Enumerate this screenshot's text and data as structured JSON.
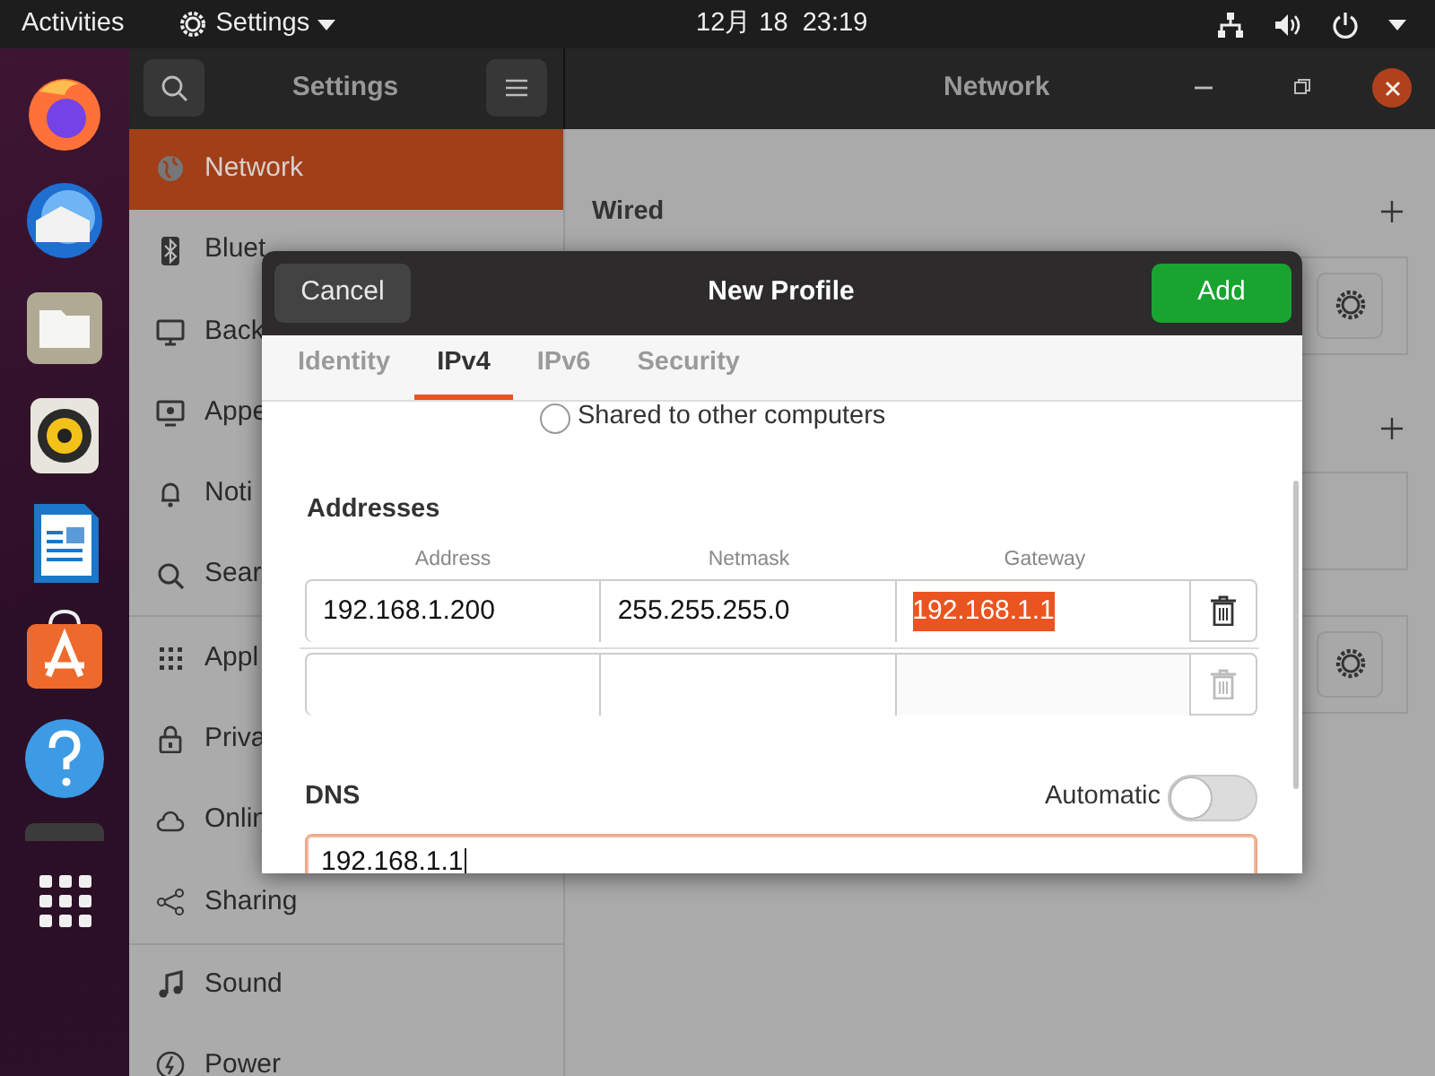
{
  "top_bar": {
    "activities": "Activities",
    "app_menu": "Settings",
    "clock": "12月 18  23:19"
  },
  "window": {
    "sidebar_title": "Settings",
    "title": "Network"
  },
  "sidebar": {
    "items": [
      {
        "label": "Network",
        "selected": true
      },
      {
        "label": "Bluet",
        "selected": false
      },
      {
        "label": "Back",
        "selected": false
      },
      {
        "label": "Appe",
        "selected": false
      },
      {
        "label": "Noti",
        "selected": false
      },
      {
        "label": "Sear",
        "selected": false
      },
      {
        "label": "Appl",
        "selected": false
      },
      {
        "label": "Priva",
        "selected": false
      },
      {
        "label": "Onlin",
        "selected": false
      },
      {
        "label": "Sharing",
        "selected": false
      },
      {
        "label": "Sound",
        "selected": false
      },
      {
        "label": "Power",
        "selected": false
      }
    ]
  },
  "network_page": {
    "wired_title": "Wired"
  },
  "dialog": {
    "title": "New Profile",
    "cancel": "Cancel",
    "add": "Add",
    "tabs": [
      {
        "label": "Identity",
        "selected": false
      },
      {
        "label": "IPv4",
        "selected": true
      },
      {
        "label": "IPv6",
        "selected": false
      },
      {
        "label": "Security",
        "selected": false
      }
    ],
    "shared_option": {
      "label": "Shared to other computers",
      "selected": false
    },
    "addresses": {
      "title": "Addresses",
      "columns": [
        "Address",
        "Netmask",
        "Gateway"
      ],
      "rows": [
        {
          "address": "192.168.1.200",
          "netmask": "255.255.255.0",
          "gateway": "192.168.1.1",
          "gateway_selected": true,
          "disabled": false
        },
        {
          "disabled": true
        }
      ]
    },
    "dns": {
      "title": "DNS",
      "automatic_label": "Automatic",
      "automatic_on": false,
      "value": "192.168.1.1",
      "focused": true
    }
  }
}
